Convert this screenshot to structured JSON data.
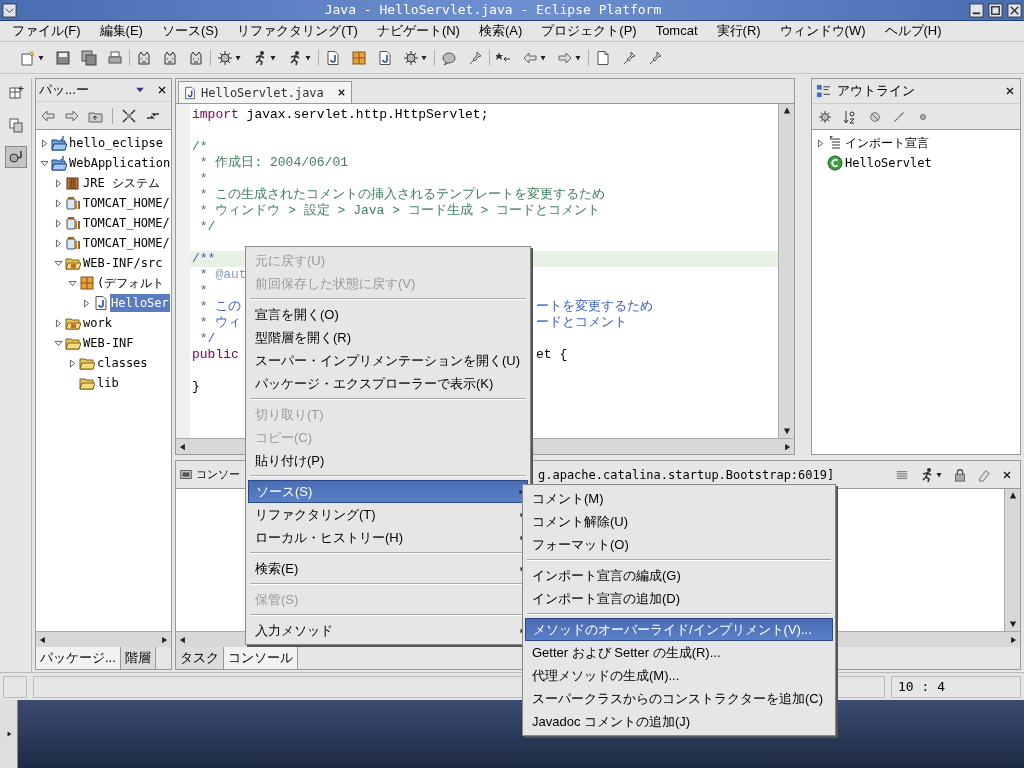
{
  "window": {
    "title": "Java - HelloServlet.java - Eclipse Platform"
  },
  "menu_bar": [
    "ファイル(F)",
    "編集(E)",
    "ソース(S)",
    "リファクタリング(T)",
    "ナビゲート(N)",
    "検索(A)",
    "プロジェクト(P)",
    "Tomcat",
    "実行(R)",
    "ウィンドウ(W)",
    "ヘルプ(H)"
  ],
  "perspective_bar": [
    {
      "selected": false
    },
    {
      "selected": false
    },
    {
      "selected": true
    }
  ],
  "package_explorer": {
    "title": "パッ...ー",
    "tree": [
      {
        "kind": "project",
        "label": "hello_eclipse",
        "expanded": false,
        "selected": false
      },
      {
        "kind": "project",
        "label": "WebApplication",
        "expanded": true,
        "selected": false,
        "children": [
          {
            "kind": "library",
            "label": "JRE システム",
            "expanded": false,
            "selected": false
          },
          {
            "kind": "jar",
            "label": "TOMCAT_HOME/",
            "expanded": false,
            "selected": false
          },
          {
            "kind": "jar",
            "label": "TOMCAT_HOME/",
            "expanded": false,
            "selected": false
          },
          {
            "kind": "jar",
            "label": "TOMCAT_HOME/",
            "expanded": false,
            "selected": false
          },
          {
            "kind": "source",
            "label": "WEB-INF/src",
            "expanded": true,
            "selected": false,
            "children": [
              {
                "kind": "package",
                "label": "(デフォルト",
                "expanded": true,
                "selected": false,
                "children": [
                  {
                    "kind": "java",
                    "label": "HelloSer",
                    "expanded": false,
                    "selected": true
                  }
                ]
              }
            ]
          },
          {
            "kind": "source",
            "label": "work",
            "expanded": false,
            "selected": false
          },
          {
            "kind": "folder",
            "label": "WEB-INF",
            "expanded": true,
            "selected": false,
            "children": [
              {
                "kind": "folder",
                "label": "classes",
                "expanded": false,
                "selected": false
              },
              {
                "kind": "folder",
                "label": "lib",
                "selected": false
              }
            ]
          }
        ]
      }
    ],
    "tabs": [
      {
        "label": "パッケージ...",
        "selected": true
      },
      {
        "label": "階層",
        "selected": false
      }
    ]
  },
  "editor": {
    "tabs": [
      {
        "label": "HelloServlet.java",
        "selected": true
      }
    ],
    "lines": [
      {
        "kind": "code",
        "current": false,
        "segments": [
          {
            "kind": "keyword",
            "text": "import"
          },
          {
            "kind": "plain",
            "text": " javax.servlet.http.HttpServlet;"
          }
        ]
      },
      {
        "kind": "blank",
        "current": false
      },
      {
        "kind": "code",
        "current": false,
        "segments": [
          {
            "kind": "comment",
            "text": "/*"
          }
        ]
      },
      {
        "kind": "code",
        "current": false,
        "segments": [
          {
            "kind": "comment",
            "text": " * 作成日: 2004/06/01"
          }
        ]
      },
      {
        "kind": "code",
        "current": false,
        "segments": [
          {
            "kind": "comment",
            "text": " *"
          }
        ]
      },
      {
        "kind": "code",
        "current": false,
        "segments": [
          {
            "kind": "comment",
            "text": " * この生成されたコメントの挿入されるテンプレートを変更するため"
          }
        ]
      },
      {
        "kind": "code",
        "current": false,
        "segments": [
          {
            "kind": "comment",
            "text": " * ウィンドウ > 設定 > Java > コード生成 > コードとコメント"
          }
        ]
      },
      {
        "kind": "code",
        "current": false,
        "segments": [
          {
            "kind": "comment",
            "text": " */"
          }
        ]
      },
      {
        "kind": "blank",
        "current": false
      },
      {
        "kind": "code",
        "current": true,
        "segments": [
          {
            "kind": "javadoc",
            "text": "/**"
          }
        ]
      },
      {
        "kind": "code",
        "current": false,
        "segments": [
          {
            "kind": "javadoc",
            "text": " * "
          },
          {
            "kind": "tag",
            "text": "@aut"
          }
        ]
      },
      {
        "kind": "code",
        "current": false,
        "segments": [
          {
            "kind": "javadoc",
            "text": " *"
          }
        ]
      },
      {
        "kind": "code",
        "current": false,
        "segments": [
          {
            "kind": "javadoc",
            "text": " * この"
          }
        ],
        "right": {
          "kind": "javadoc",
          "text": "ートを変更するため"
        }
      },
      {
        "kind": "code",
        "current": false,
        "segments": [
          {
            "kind": "javadoc",
            "text": " * ウィ"
          }
        ],
        "right": {
          "kind": "javadoc",
          "text": "ードとコメント"
        }
      },
      {
        "kind": "code",
        "current": false,
        "segments": [
          {
            "kind": "javadoc",
            "text": " */"
          }
        ]
      },
      {
        "kind": "code",
        "current": false,
        "segments": [
          {
            "kind": "keyword",
            "text": "public"
          }
        ],
        "right": {
          "kind": "plain",
          "text": "et {"
        }
      },
      {
        "kind": "blank",
        "current": false
      },
      {
        "kind": "code",
        "current": false,
        "segments": [
          {
            "kind": "plain",
            "text": "}"
          }
        ]
      }
    ]
  },
  "outline": {
    "title": "アウトライン",
    "tree": [
      {
        "kind": "imports",
        "label": "インポート宣言",
        "expanded": false
      },
      {
        "kind": "class",
        "label": "HelloServlet"
      }
    ]
  },
  "console": {
    "title": "コンソー",
    "title_right": "g.apache.catalina.startup.Bootstrap:6019]",
    "tabs": [
      {
        "label": "タスク",
        "selected": false
      },
      {
        "label": "コンソール",
        "selected": true
      }
    ]
  },
  "status_bar": {
    "position": "10 : 4"
  },
  "context_menu": {
    "items": [
      {
        "kind": "item",
        "label": "元に戻す(U)",
        "disabled": true,
        "selected": false,
        "submenu": false
      },
      {
        "kind": "item",
        "label": "前回保存した状態に戻す(V)",
        "disabled": true,
        "selected": false,
        "submenu": false
      },
      {
        "kind": "separator"
      },
      {
        "kind": "item",
        "label": "宣言を開く(O)",
        "disabled": false,
        "selected": false,
        "submenu": false
      },
      {
        "kind": "item",
        "label": "型階層を開く(R)",
        "disabled": false,
        "selected": false,
        "submenu": false
      },
      {
        "kind": "item",
        "label": "スーパー・インプリメンテーションを開く(U)",
        "disabled": false,
        "selected": false,
        "submenu": false
      },
      {
        "kind": "item",
        "label": "パッケージ・エクスプローラーで表示(K)",
        "disabled": false,
        "selected": false,
        "submenu": false
      },
      {
        "kind": "separator"
      },
      {
        "kind": "item",
        "label": "切り取り(T)",
        "disabled": true,
        "selected": false,
        "submenu": false
      },
      {
        "kind": "item",
        "label": "コピー(C)",
        "disabled": true,
        "selected": false,
        "submenu": false
      },
      {
        "kind": "item",
        "label": "貼り付け(P)",
        "disabled": false,
        "selected": false,
        "submenu": false
      },
      {
        "kind": "separator"
      },
      {
        "kind": "item",
        "label": "ソース(S)",
        "disabled": false,
        "selected": true,
        "submenu": true
      },
      {
        "kind": "item",
        "label": "リファクタリング(T)",
        "disabled": false,
        "selected": false,
        "submenu": true
      },
      {
        "kind": "item",
        "label": "ローカル・ヒストリー(H)",
        "disabled": false,
        "selected": false,
        "submenu": true
      },
      {
        "kind": "separator"
      },
      {
        "kind": "item",
        "label": "検索(E)",
        "disabled": false,
        "selected": false,
        "submenu": true
      },
      {
        "kind": "separator"
      },
      {
        "kind": "item",
        "label": "保管(S)",
        "disabled": true,
        "selected": false,
        "submenu": false
      },
      {
        "kind": "separator"
      },
      {
        "kind": "item",
        "label": "入力メソッド",
        "disabled": false,
        "selected": false,
        "submenu": true
      }
    ]
  },
  "submenu": {
    "items": [
      {
        "kind": "item",
        "label": "コメント(M)",
        "disabled": false,
        "selected": false,
        "submenu": false
      },
      {
        "kind": "item",
        "label": "コメント解除(U)",
        "disabled": false,
        "selected": false,
        "submenu": false
      },
      {
        "kind": "item",
        "label": "フォーマット(O)",
        "disabled": false,
        "selected": false,
        "submenu": false
      },
      {
        "kind": "separator"
      },
      {
        "kind": "item",
        "label": "インポート宣言の編成(G)",
        "disabled": false,
        "selected": false,
        "submenu": false
      },
      {
        "kind": "item",
        "label": "インポート宣言の追加(D)",
        "disabled": false,
        "selected": false,
        "submenu": false
      },
      {
        "kind": "separator"
      },
      {
        "kind": "item",
        "label": "メソッドのオーバーライド/インプリメント(V)...",
        "disabled": false,
        "selected": true,
        "submenu": false
      },
      {
        "kind": "item",
        "label": "Getter および Setter の生成(R)...",
        "disabled": false,
        "selected": false,
        "submenu": false
      },
      {
        "kind": "item",
        "label": "代理メソッドの生成(M)...",
        "disabled": false,
        "selected": false,
        "submenu": false
      },
      {
        "kind": "item",
        "label": "スーパークラスからのコンストラクターを追加(C)",
        "disabled": false,
        "selected": false,
        "submenu": false
      },
      {
        "kind": "item",
        "label": "Javadoc コメントの追加(J)",
        "disabled": false,
        "selected": false,
        "submenu": false
      }
    ]
  }
}
